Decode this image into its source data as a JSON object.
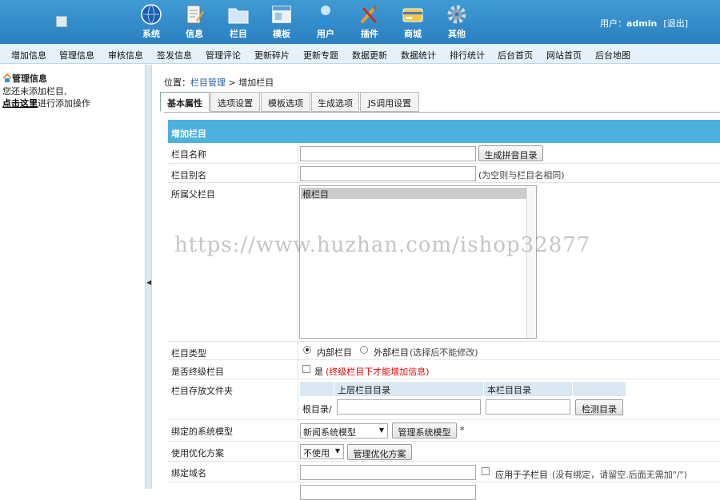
{
  "header": {
    "nav": [
      {
        "label": "系统",
        "icon": "globe-icon"
      },
      {
        "label": "信息",
        "icon": "notepad-icon"
      },
      {
        "label": "栏目",
        "icon": "folder-icon"
      },
      {
        "label": "模板",
        "icon": "window-icon"
      },
      {
        "label": "用户",
        "icon": "user-icon"
      },
      {
        "label": "插件",
        "icon": "tools-icon"
      },
      {
        "label": "商城",
        "icon": "card-icon"
      },
      {
        "label": "其他",
        "icon": "gear-icon"
      }
    ],
    "user_prefix": "用户：",
    "username": "admin",
    "logout": "[退出]"
  },
  "menu": [
    "增加信息",
    "管理信息",
    "审核信息",
    "签发信息",
    "管理评论",
    "更新碎片",
    "更新专题",
    "数据更新",
    "数据统计",
    "排行统计",
    "后台首页",
    "网站首页",
    "后台地图"
  ],
  "sidebar": {
    "title": "管理信息",
    "line1": "您还未添加栏目,",
    "link": "点击这里",
    "line2": "进行添加操作"
  },
  "breadcrumb": {
    "prefix": "位置：",
    "link": "栏目管理",
    "sep": " > ",
    "current": "增加栏目"
  },
  "tabs": [
    "基本属性",
    "选项设置",
    "模板选项",
    "生成选项",
    "JS调用设置"
  ],
  "form": {
    "title": "增加栏目",
    "name_label": "栏目名称",
    "pinyin_btn": "生成拼音目录",
    "alias_label": "栏目别名",
    "alias_hint": "(为空则与栏目名相同)",
    "parent_label": "所属父栏目",
    "parent_option": "根栏目",
    "type_label": "栏目类型",
    "type_internal": "内部栏目",
    "type_external": "外部栏目",
    "type_hint": "(选择后不能修改)",
    "final_label": "是否终级栏目",
    "final_yes": "是",
    "final_hint": "(终级栏目下才能增加信息)",
    "folder_label": "栏目存放文件夹",
    "folder_head_parent": "上层栏目目录",
    "folder_head_this": "本栏目目录",
    "folder_root": "根目录/",
    "check_btn": "检测目录",
    "model_label": "绑定的系统模型",
    "model_value": "新闻系统模型",
    "model_btn": "管理系统模型",
    "model_star": "*",
    "opt_label": "使用优化方案",
    "opt_value": "不使用",
    "opt_btn": "管理优化方案",
    "domain_label": "绑定域名",
    "domain_sub": "应用于子栏目",
    "domain_hint": "(没有绑定，请留空.后面无需加\"/\")"
  },
  "watermark": "https://www.huzhan.com/ishop32877",
  "colors": {
    "header": "#2a7fc0",
    "form_head": "#4cb1de",
    "menu_bg": "#e5f2fb",
    "warn": "#e00000"
  }
}
